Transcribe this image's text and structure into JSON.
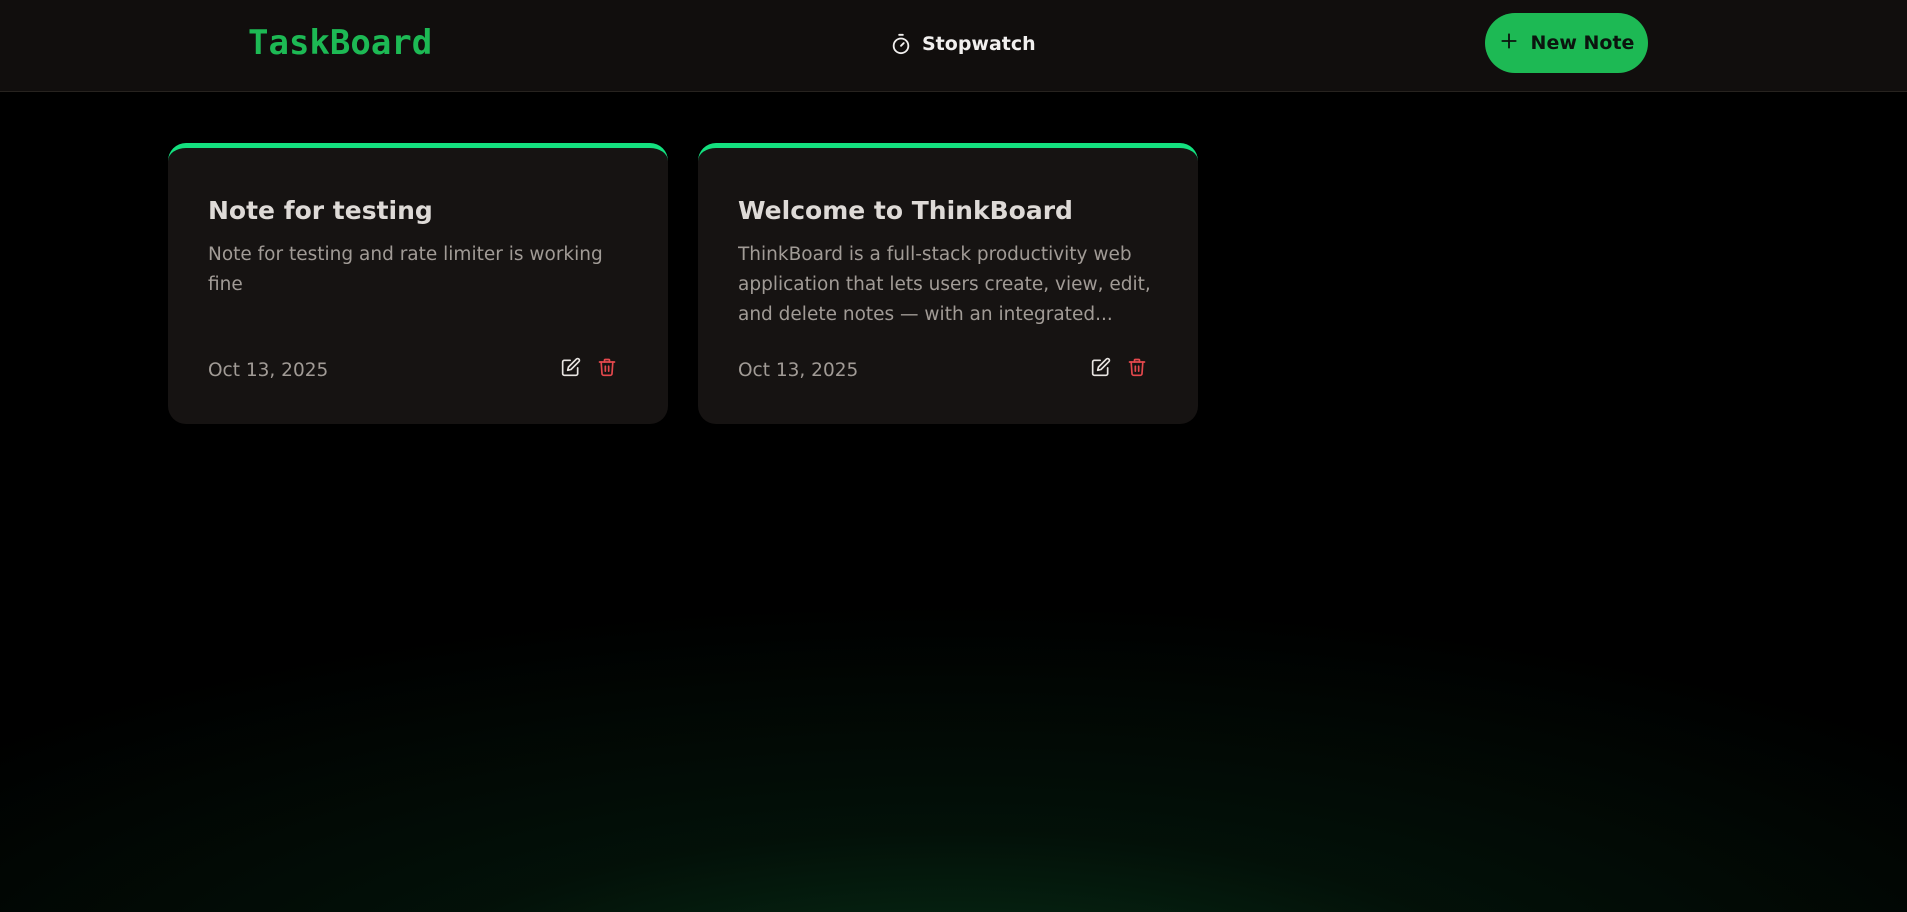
{
  "header": {
    "logo": "TaskBoard",
    "stopwatch_label": "Stopwatch",
    "new_note_label": "New Note"
  },
  "notes": [
    {
      "title": "Note for testing",
      "body": "Note for testing and rate limiter is working fine",
      "date": "Oct 13, 2025"
    },
    {
      "title": "Welcome to ThinkBoard",
      "body": "ThinkBoard is a full-stack productivity web application that lets users create, view, edit, and delete notes — with an integrated...",
      "date": "Oct 13, 2025"
    }
  ],
  "colors": {
    "accent": "#1db954",
    "card_top_border": "#14e07f",
    "delete": "#e5484d"
  },
  "icons": {
    "stopwatch": "stopwatch-icon",
    "plus": "plus-icon",
    "edit": "edit-icon",
    "delete": "trash-icon"
  }
}
